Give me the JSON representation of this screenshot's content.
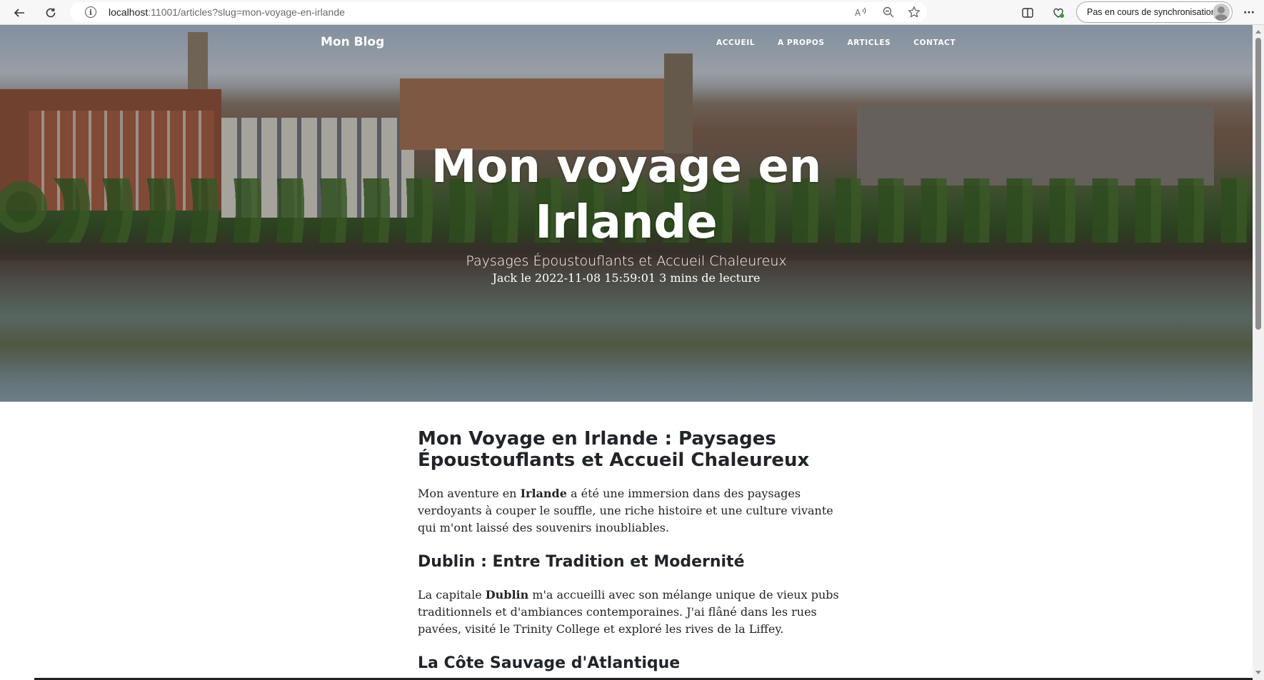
{
  "browser": {
    "back_icon": "arrow-left-icon",
    "reload_icon": "reload-icon",
    "url_host": "localhost",
    "url_rest": ":11001/articles?slug=mon-voyage-en-irlande",
    "sync_label": "Pas en cours de synchronisation",
    "menu_glyph": "···"
  },
  "nav": {
    "brand": "Mon Blog",
    "links": [
      "ACCUEIL",
      "A PROPOS",
      "ARTICLES",
      "CONTACT"
    ]
  },
  "hero": {
    "title_line1": "Mon voyage en",
    "title_line2": "Irlande",
    "subtitle": "Paysages Époustouflants et Accueil Chaleureux",
    "meta": "Jack le 2022-11-08 15:59:01 3 mins de lecture"
  },
  "article": {
    "heading": "Mon Voyage en Irlande : Paysages Époustouflants et Accueil Chaleureux",
    "p1_before": "Mon aventure en ",
    "p1_bold": "Irlande",
    "p1_after": " a été une immersion dans des paysages verdoyants à couper le souffle, une riche histoire et une culture vivante qui m'ont laissé des souvenirs inoubliables.",
    "section1_title": "Dublin : Entre Tradition et Modernité",
    "p2_before": "La capitale ",
    "p2_bold": "Dublin",
    "p2_after": " m'a accueilli avec son mélange unique de vieux pubs traditionnels et d'ambiances contemporaines. J'ai flâné dans les rues pavées, visité le Trinity College et exploré les rives de la Liffey.",
    "section2_title": "La Côte Sauvage d'Atlantique"
  }
}
